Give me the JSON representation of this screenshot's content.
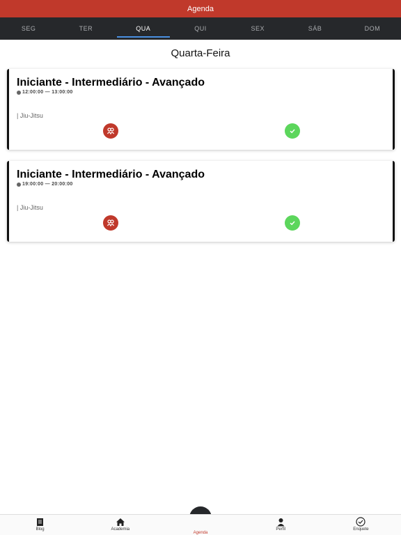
{
  "header": {
    "title": "Agenda"
  },
  "days": [
    {
      "label": "SEG",
      "active": false
    },
    {
      "label": "TER",
      "active": false
    },
    {
      "label": "QUA",
      "active": true
    },
    {
      "label": "QUI",
      "active": false
    },
    {
      "label": "SEX",
      "active": false
    },
    {
      "label": "SÁB",
      "active": false
    },
    {
      "label": "DOM",
      "active": false
    }
  ],
  "day_title": "Quarta-Feira",
  "classes": [
    {
      "title": "Iniciante - Intermediário - Avançado",
      "time": "12:00:00 — 13:00:00",
      "modality": "| Jiu-Jitsu"
    },
    {
      "title": "Iniciante - Intermediário - Avançado",
      "time": "19:00:00 — 20:00:00",
      "modality": "| Jiu-Jitsu"
    }
  ],
  "nav": [
    {
      "label": "Blog",
      "icon": "book-icon"
    },
    {
      "label": "Academia",
      "icon": "home-icon"
    },
    {
      "label": "Agenda",
      "icon": "calendar-icon",
      "active": true
    },
    {
      "label": "Perfil",
      "icon": "person-icon"
    },
    {
      "label": "Enquete",
      "icon": "check-circle-icon"
    }
  ],
  "colors": {
    "brand": "#c0392b",
    "dark": "#26282b",
    "check": "#5cd65c",
    "tab_indicator": "#4a90e2"
  }
}
